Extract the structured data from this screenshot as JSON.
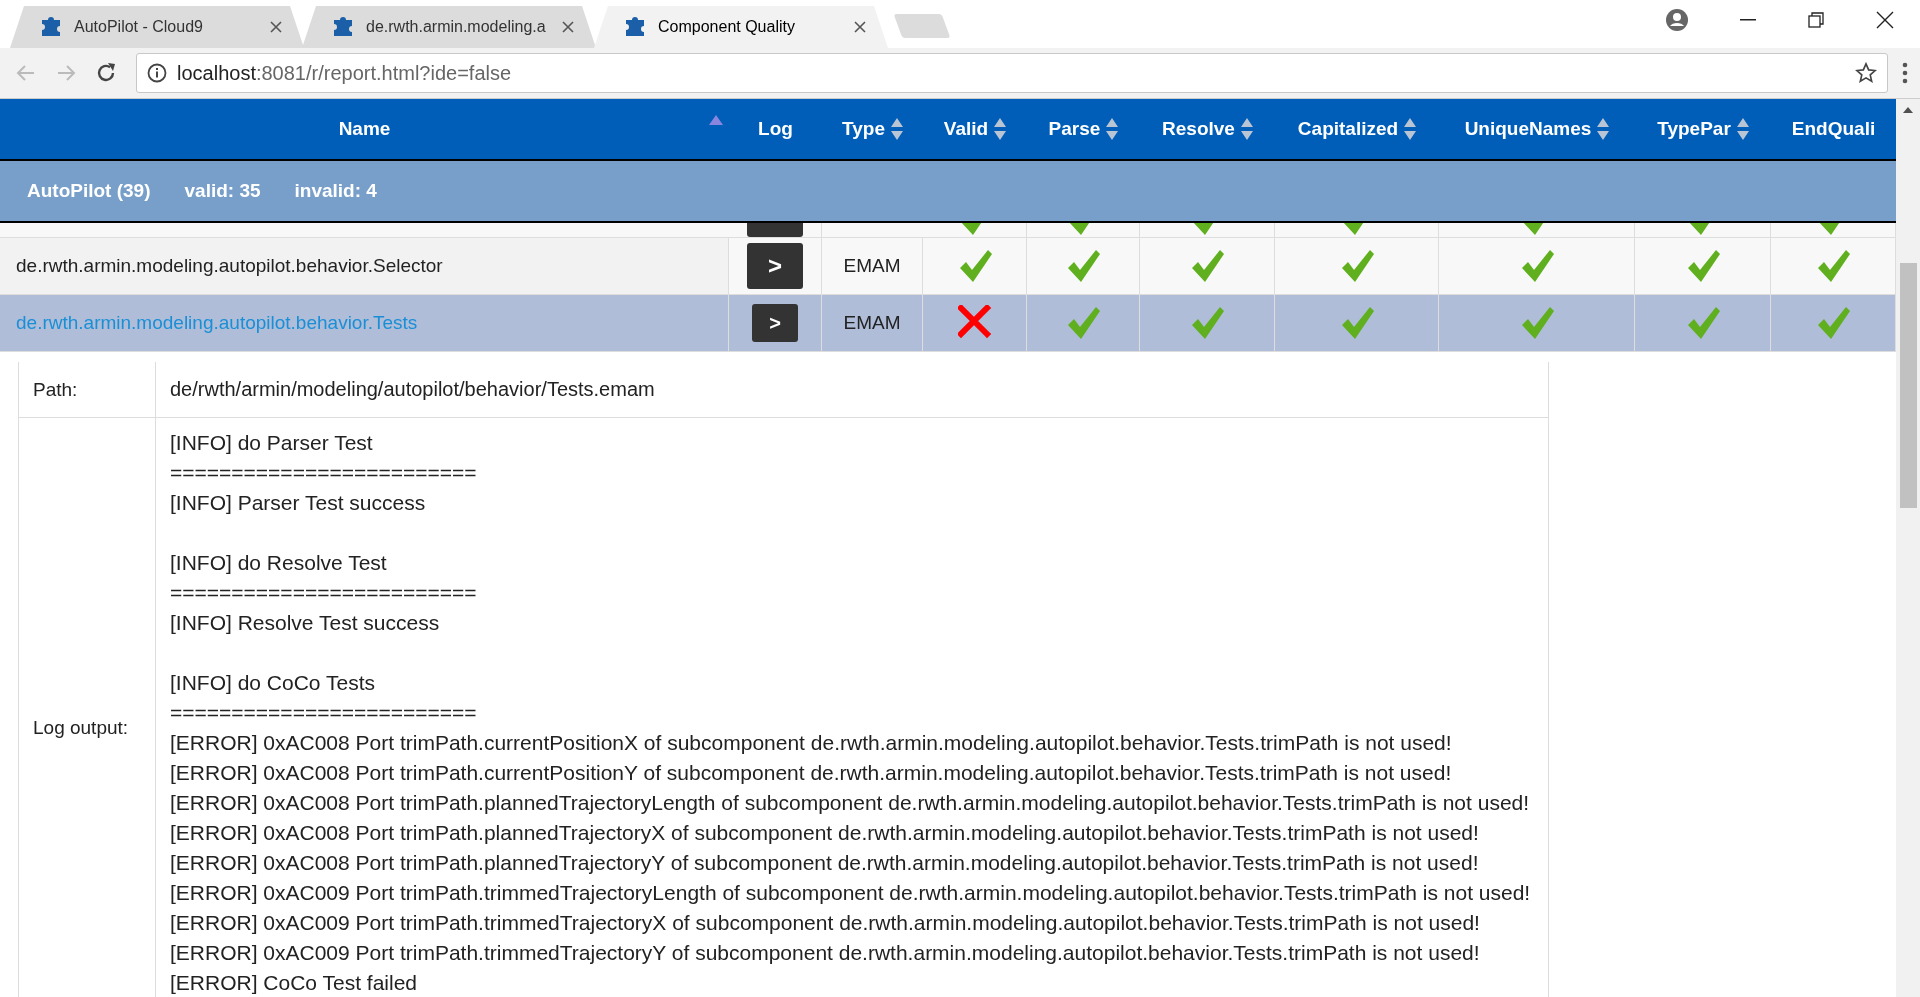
{
  "tabs": [
    {
      "title": "AutoPilot - Cloud9",
      "selected": false
    },
    {
      "title": "de.rwth.armin.modeling.a",
      "selected": false
    },
    {
      "title": "Component Quality",
      "selected": true
    }
  ],
  "address": {
    "host": "localhost",
    "path": ":8081/r/report.html?ide=false"
  },
  "table": {
    "columns": [
      {
        "label": "Name",
        "kind": "sorted"
      },
      {
        "label": "Log",
        "kind": "plain"
      },
      {
        "label": "Type",
        "kind": "sortable"
      },
      {
        "label": "Valid",
        "kind": "sortable"
      },
      {
        "label": "Parse",
        "kind": "sortable"
      },
      {
        "label": "Resolve",
        "kind": "sortable"
      },
      {
        "label": "Capitalized",
        "kind": "sortable"
      },
      {
        "label": "UniqueNames",
        "kind": "sortable"
      },
      {
        "label": "TypePar",
        "kind": "sortable"
      },
      {
        "label": "EndQuali",
        "kind": "plain"
      }
    ],
    "summary": [
      "AutoPilot (39)",
      "valid: 35",
      "invalid: 4"
    ],
    "rows": [
      {
        "selected": false,
        "checks": [
          true,
          true,
          true,
          true,
          true,
          true,
          true
        ]
      },
      {
        "name": "de.rwth.armin.modeling.autopilot.behavior.Selector",
        "log_button": ">",
        "type": "EMAM",
        "selected": false,
        "checks": [
          true,
          true,
          true,
          true,
          true,
          true,
          true
        ]
      },
      {
        "name": "de.rwth.armin.modeling.autopilot.behavior.Tests",
        "log_button": ">",
        "type": "EMAM",
        "selected": true,
        "checks": [
          false,
          true,
          true,
          true,
          true,
          true,
          true
        ]
      }
    ]
  },
  "detail": {
    "path_label": "Path:",
    "path": "de/rwth/armin/modeling/autopilot/behavior/Tests.emam",
    "log_label": "Log output:",
    "log_blocks": [
      [
        "[INFO] do Parser Test",
        "=========================",
        "[INFO] Parser Test success"
      ],
      [
        "[INFO] do Resolve Test",
        "=========================",
        "[INFO] Resolve Test success"
      ],
      [
        "[INFO] do CoCo Tests",
        "=========================",
        "[ERROR] 0xAC008 Port trimPath.currentPositionX of subcomponent de.rwth.armin.modeling.autopilot.behavior.Tests.trimPath is not used!",
        "[ERROR] 0xAC008 Port trimPath.currentPositionY of subcomponent de.rwth.armin.modeling.autopilot.behavior.Tests.trimPath is not used!",
        "[ERROR] 0xAC008 Port trimPath.plannedTrajectoryLength of subcomponent de.rwth.armin.modeling.autopilot.behavior.Tests.trimPath is not used!",
        "[ERROR] 0xAC008 Port trimPath.plannedTrajectoryX of subcomponent de.rwth.armin.modeling.autopilot.behavior.Tests.trimPath is not used!",
        "[ERROR] 0xAC008 Port trimPath.plannedTrajectoryY of subcomponent de.rwth.armin.modeling.autopilot.behavior.Tests.trimPath is not used!",
        "[ERROR] 0xAC009 Port trimPath.trimmedTrajectoryLength of subcomponent de.rwth.armin.modeling.autopilot.behavior.Tests.trimPath is not used!",
        "[ERROR] 0xAC009 Port trimPath.trimmedTrajectoryX of subcomponent de.rwth.armin.modeling.autopilot.behavior.Tests.trimPath is not used!",
        "[ERROR] 0xAC009 Port trimPath.trimmedTrajectoryY of subcomponent de.rwth.armin.modeling.autopilot.behavior.Tests.trimPath is not used!",
        "[ERROR] CoCo Test failed"
      ]
    ]
  }
}
